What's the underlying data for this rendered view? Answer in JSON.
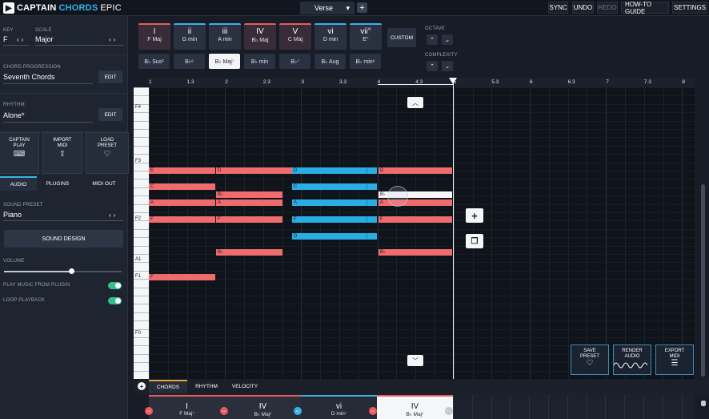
{
  "app": {
    "title_a": "CAPTAIN",
    "title_b": "CHORDS",
    "title_c": "EPIC"
  },
  "topbar": {
    "section": "Verse",
    "add_section": "+",
    "buttons": [
      {
        "label": "SYNC"
      },
      {
        "label": "UNDO"
      },
      {
        "label": "REDO"
      },
      {
        "label": "HOW-TO GUIDE"
      },
      {
        "label": "SETTINGS"
      }
    ]
  },
  "sidebar": {
    "key_label": "KEY",
    "key_value": "F",
    "scale_label": "SCALE",
    "scale_value": "Major",
    "progression_label": "CHORD PROGRESSION",
    "progression_value": "Seventh Chords",
    "edit": "EDIT",
    "rhythm_label": "RHYTHM",
    "rhythm_value": "Alone*",
    "tiles": [
      {
        "line1": "CAPTAIN",
        "line2": "PLAY",
        "icon": "keyboard-icon"
      },
      {
        "line1": "IMPORT",
        "line2": "MIDI",
        "icon": "upload-icon"
      },
      {
        "line1": "LOAD",
        "line2": "PRESET",
        "icon": "heart-icon"
      }
    ],
    "subtabs": [
      {
        "label": "AUDIO"
      },
      {
        "label": "PLUGINS"
      },
      {
        "label": "MIDI OUT"
      }
    ],
    "sound_preset_label": "SOUND PRESET",
    "sound_preset_value": "Piano",
    "sound_design": "SOUND DESIGN",
    "volume_label": "VOLUME",
    "volume_level": 0.57,
    "play_from_plugin": "PLAY MUSIC FROM PLUGIN",
    "loop_playback": "LOOP PLAYBACK"
  },
  "chords": [
    {
      "numeral": "I",
      "name": "F Maj",
      "color": "red"
    },
    {
      "numeral": "ii",
      "name": "G min",
      "color": "blue"
    },
    {
      "numeral": "iii",
      "name": "A min",
      "color": "blue"
    },
    {
      "numeral": "IV",
      "name": "B♭ Maj",
      "color": "red"
    },
    {
      "numeral": "V",
      "name": "C Maj",
      "color": "red"
    },
    {
      "numeral": "vi",
      "name": "D min",
      "color": "blue"
    },
    {
      "numeral": "vii°",
      "name": "E°",
      "color": "blue"
    }
  ],
  "variations": [
    {
      "label": "B♭ Sus²"
    },
    {
      "label": "B♭⁶"
    },
    {
      "label": "B♭ Maj⁷",
      "selected": true
    },
    {
      "label": "B♭ min"
    },
    {
      "label": "B♭⁷"
    },
    {
      "label": "B♭ Aug"
    },
    {
      "label": "B♭ min⁶"
    }
  ],
  "custom": "CUSTOM",
  "octave_label": "OCTAVE",
  "complexity_label": "COMPLEXITY",
  "ruler": [
    "1",
    "1.3",
    "2",
    "2.3",
    "3",
    "3.3",
    "4",
    "4.3",
    "5",
    "5.3",
    "6",
    "6.3",
    "7",
    "7.3",
    "8"
  ],
  "key_labels": [
    "F4",
    "F3",
    "F2",
    "A1",
    "F1",
    "F0"
  ],
  "notes": [
    {
      "label": "E",
      "color": "r"
    },
    {
      "label": "D",
      "color": "r"
    },
    {
      "label": "D",
      "color": "b"
    },
    {
      "label": "D",
      "color": "r"
    },
    {
      "label": "C",
      "color": "r"
    },
    {
      "label": "C",
      "color": "b"
    },
    {
      "label": "B♭",
      "color": "r"
    },
    {
      "label": "B♭",
      "color": "w"
    },
    {
      "label": "A",
      "color": "r"
    },
    {
      "label": "A",
      "color": "r"
    },
    {
      "label": "A",
      "color": "b"
    },
    {
      "label": "A",
      "color": "r"
    },
    {
      "label": "F",
      "color": "r"
    },
    {
      "label": "F",
      "color": "r"
    },
    {
      "label": "F",
      "color": "b"
    },
    {
      "label": "F",
      "color": "r"
    },
    {
      "label": "D",
      "color": "b"
    },
    {
      "label": "B♭",
      "color": "r"
    },
    {
      "label": "B♭",
      "color": "r"
    },
    {
      "label": "F",
      "color": "r"
    }
  ],
  "actions": [
    {
      "line1": "SAVE",
      "line2": "PRESET",
      "icon": "heart-icon"
    },
    {
      "line1": "RENDER",
      "line2": "AUDIO",
      "icon": "waveform-icon"
    },
    {
      "line1": "EXPORT",
      "line2": "MIDI",
      "icon": "midi-file-icon"
    }
  ],
  "bottom_tabs": [
    {
      "label": "CHORDS"
    },
    {
      "label": "RHYTHM"
    },
    {
      "label": "VELOCITY"
    }
  ],
  "timeline": [
    {
      "numeral": "I",
      "name": "F Maj⁷"
    },
    {
      "numeral": "IV",
      "name": "B♭ Maj⁷"
    },
    {
      "numeral": "vi",
      "name": "D min⁷"
    },
    {
      "numeral": "IV",
      "name": "B♭ Maj⁷"
    }
  ],
  "colors": {
    "red": "#ef6b6e",
    "blue": "#29aee4",
    "accent": "#3ab2e6",
    "toggle": "#35c08a"
  }
}
